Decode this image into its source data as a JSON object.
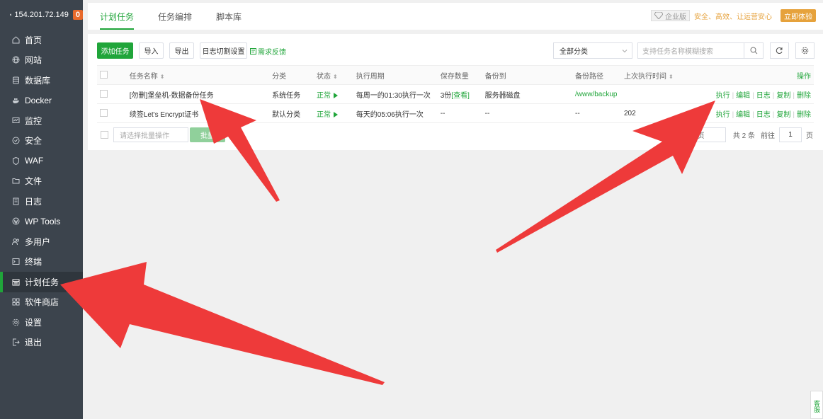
{
  "sidebar": {
    "ip": "154.201.72.149",
    "badge": "0",
    "items": [
      {
        "label": "首页",
        "icon": "home-icon"
      },
      {
        "label": "网站",
        "icon": "globe-icon"
      },
      {
        "label": "数据库",
        "icon": "database-icon"
      },
      {
        "label": "Docker",
        "icon": "docker-icon"
      },
      {
        "label": "监控",
        "icon": "monitor-icon"
      },
      {
        "label": "安全",
        "icon": "shield-icon"
      },
      {
        "label": "WAF",
        "icon": "waf-shield-icon"
      },
      {
        "label": "文件",
        "icon": "folder-icon"
      },
      {
        "label": "日志",
        "icon": "log-icon"
      },
      {
        "label": "WP Tools",
        "icon": "wordpress-icon"
      },
      {
        "label": "多用户",
        "icon": "users-icon"
      },
      {
        "label": "终端",
        "icon": "terminal-icon"
      },
      {
        "label": "计划任务",
        "icon": "calendar-icon",
        "active": true
      },
      {
        "label": "软件商店",
        "icon": "grid-icon"
      },
      {
        "label": "设置",
        "icon": "gear-icon"
      },
      {
        "label": "退出",
        "icon": "logout-icon"
      }
    ]
  },
  "topbar": {
    "tabs": [
      "计划任务",
      "任务编排",
      "脚本库"
    ],
    "edition": "企业版",
    "slogan": "安全、高效、让运营安心",
    "try_label": "立即体验"
  },
  "toolbar": {
    "add_task": "添加任务",
    "import": "导入",
    "export": "导出",
    "log_cut": "日志切割设置",
    "feedback": "需求反馈",
    "category": "全部分类",
    "search_placeholder": "支持任务名称模糊搜索"
  },
  "table": {
    "headers": [
      "任务名称",
      "分类",
      "状态",
      "执行周期",
      "保存数量",
      "备份到",
      "备份路径",
      "上次执行时间",
      "操作"
    ],
    "rows": [
      {
        "name": "[勿删]堡垒机-数据备份任务",
        "category": "系统任务",
        "status": "正常",
        "cycle": "每周一的01:30执行一次",
        "keep": "3份",
        "keep_link": "[查看]",
        "backup_to": "服务器磁盘",
        "backup_path": "/www/backup",
        "last_run": "",
        "ops": [
          "执行",
          "编辑",
          "日志",
          "复制",
          "删除"
        ]
      },
      {
        "name": "续签Let's Encrypt证书",
        "category": "默认分类",
        "status": "正常",
        "cycle": "每天的05:06执行一次",
        "keep": "--",
        "keep_link": "",
        "backup_to": "--",
        "backup_path": "--",
        "last_run": "202",
        "ops": [
          "执行",
          "编辑",
          "日志",
          "复制",
          "删除"
        ]
      }
    ]
  },
  "footer": {
    "bulk_placeholder": "请选择批量操作",
    "bulk_button": "批量",
    "page_size": "条/页",
    "total": "共 2 条",
    "goto": "前往",
    "page": "1",
    "page_suffix": "页"
  },
  "helper": {
    "label": "客服"
  },
  "colors": {
    "accent": "#20a53a",
    "sidebar": "#3c444d",
    "arrow": "#ee3a3a",
    "warning": "#e6a23c"
  }
}
